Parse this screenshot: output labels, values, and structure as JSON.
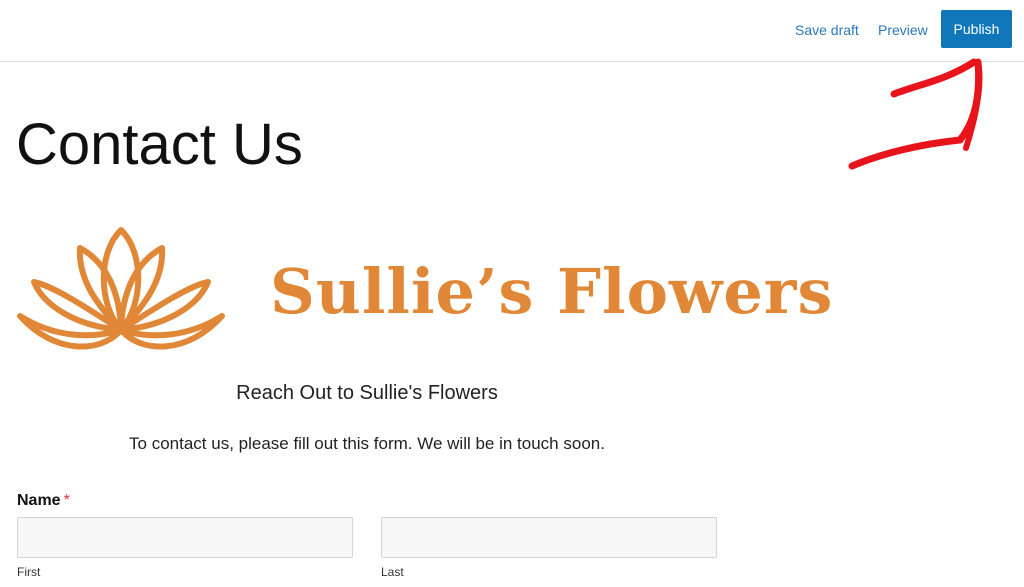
{
  "toolbar": {
    "save_draft_label": "Save draft",
    "preview_label": "Preview",
    "publish_label": "Publish"
  },
  "page": {
    "title": "Contact Us"
  },
  "brand": {
    "name": "Sullie’s Flowers",
    "logo_icon": "lotus-icon",
    "color": "#e08837"
  },
  "form": {
    "heading": "Reach Out to Sullie's Flowers",
    "description": "To contact us, please fill out this form. We will be in touch soon.",
    "name_field": {
      "label": "Name",
      "required_marker": "*",
      "first": {
        "value": "",
        "sublabel": "First"
      },
      "last": {
        "value": "",
        "sublabel": "Last"
      }
    }
  },
  "annotation": {
    "icon": "hand-drawn-arrow-icon",
    "color": "#e8141c"
  },
  "colors": {
    "accent": "#0f76ba",
    "link": "#2b79b6",
    "required": "#d63638"
  }
}
